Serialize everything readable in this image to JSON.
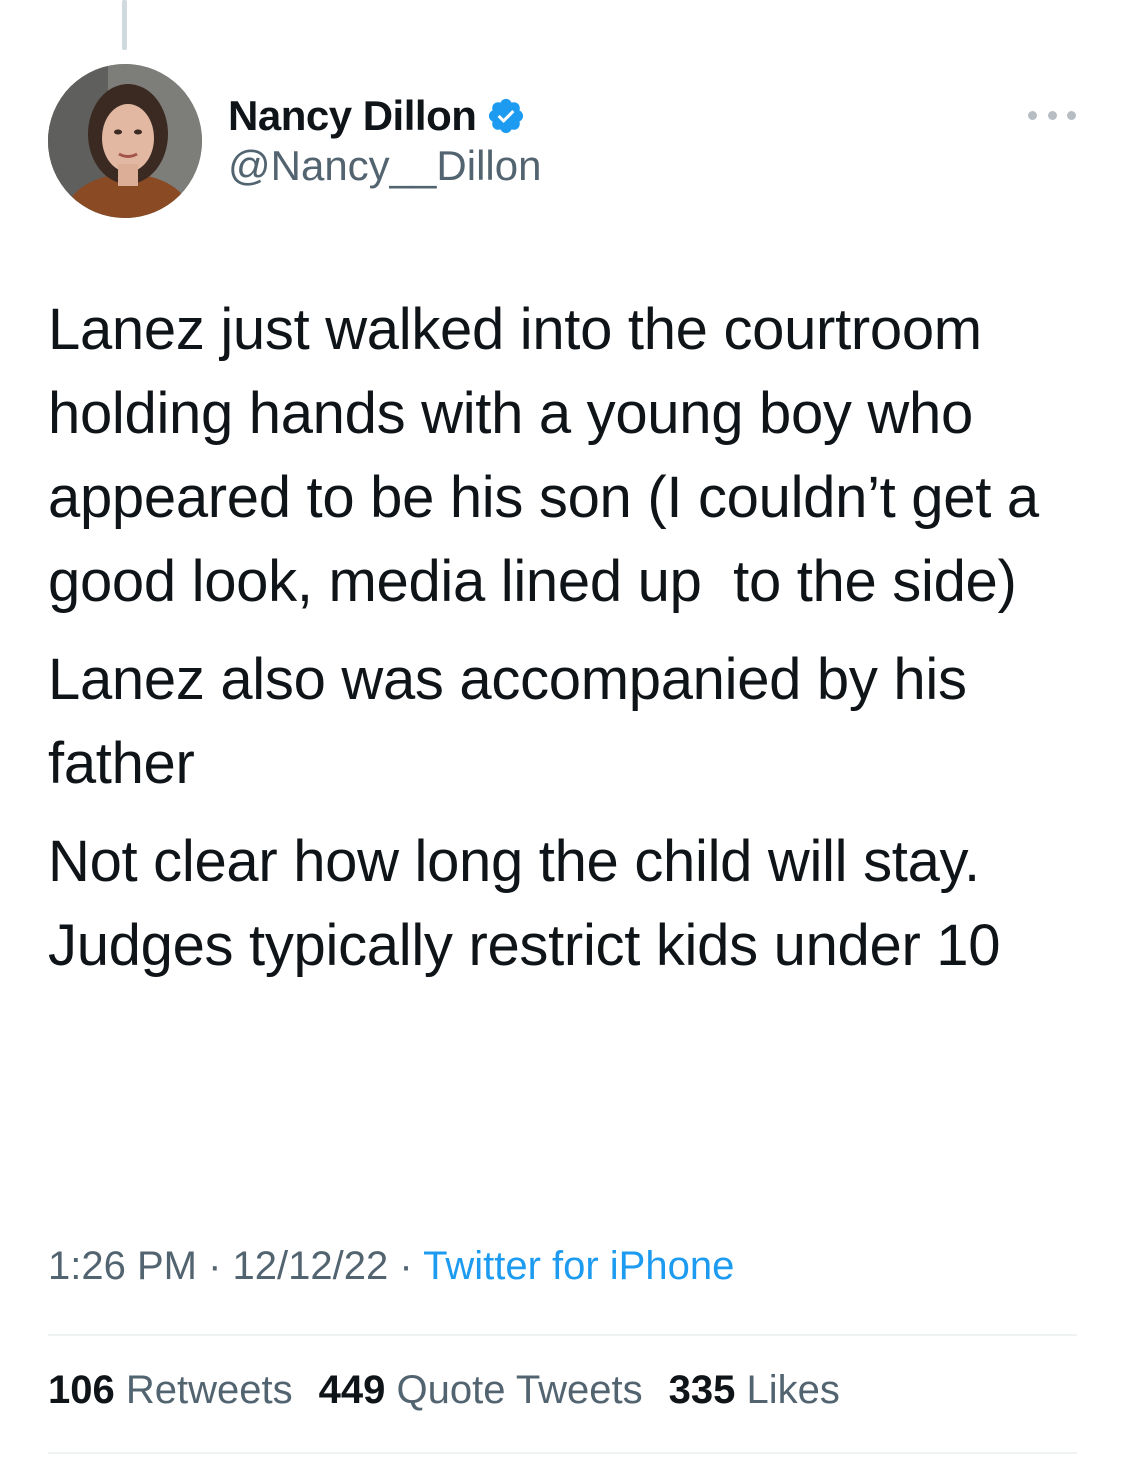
{
  "tweet": {
    "author": {
      "display_name": "Nancy Dillon",
      "handle": "@Nancy__Dillon",
      "verified": true
    },
    "paragraphs": [
      "Lanez just walked into the courtroom holding hands with a young boy who appeared to be his son (I couldn’t get a good look, media lined up  to the side)",
      "Lanez also was accompanied by his father",
      "Not clear how long the child will stay. Judges typically restrict kids under 10"
    ],
    "time": "1:26 PM",
    "separator": "·",
    "date": "12/12/22",
    "source": "Twitter for iPhone",
    "stats": {
      "retweets": {
        "count": "106",
        "label": "Retweets"
      },
      "quote_tweets": {
        "count": "449",
        "label": "Quote Tweets"
      },
      "likes": {
        "count": "335",
        "label": "Likes"
      }
    }
  },
  "colors": {
    "text": "#0f1419",
    "secondary": "#536471",
    "link": "#1d9bf0",
    "verified": "#1d9bf0",
    "divider": "#eff3f4"
  },
  "icons": {
    "verified": "verified-badge-icon",
    "more": "more-horizontal-icon"
  }
}
